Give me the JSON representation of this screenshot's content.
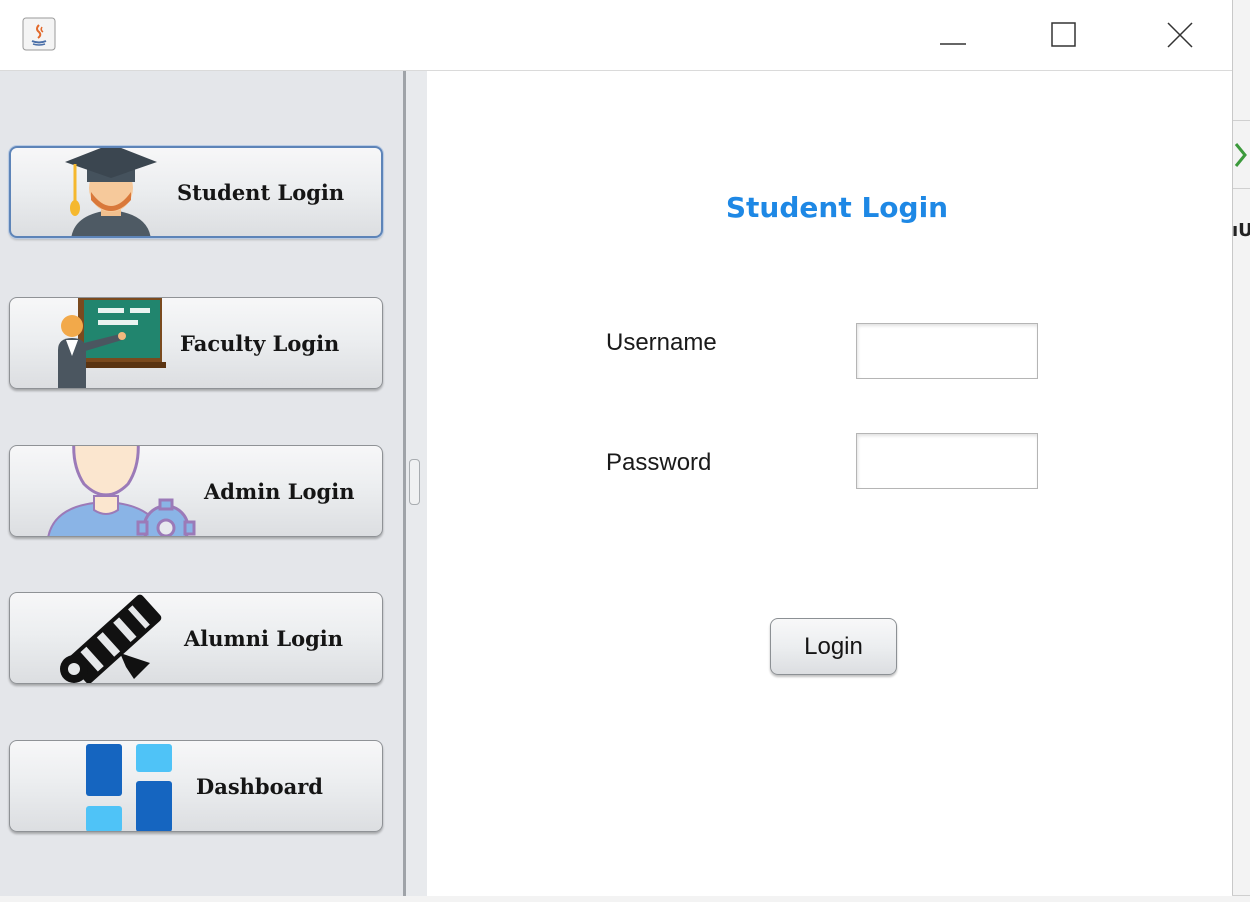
{
  "window": {
    "title": "",
    "controls": {
      "minimize": "minimize-icon",
      "maximize": "maximize-icon",
      "close": "close-icon"
    }
  },
  "sidebar": {
    "items": [
      {
        "label": "Student Login",
        "icon": "graduate-icon",
        "active": true
      },
      {
        "label": "Faculty Login",
        "icon": "teacher-blackboard-icon",
        "active": false
      },
      {
        "label": "Admin Login",
        "icon": "admin-user-gear-icon",
        "active": false
      },
      {
        "label": "Alumni Login",
        "icon": "diploma-scroll-icon",
        "active": false
      },
      {
        "label": "Dashboard",
        "icon": "dashboard-tiles-icon",
        "active": false
      }
    ]
  },
  "form": {
    "title": "Student Login",
    "username_label": "Username",
    "username_value": "",
    "password_label": "Password",
    "password_value": "",
    "login_label": "Login"
  },
  "background": {
    "fragment_text": "ıU"
  },
  "colors": {
    "title_blue": "#1e88e5",
    "sidebar_bg": "#e4e6ea",
    "active_border": "#5d84b8"
  }
}
